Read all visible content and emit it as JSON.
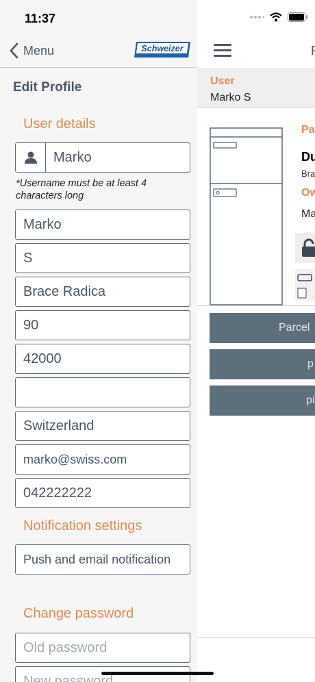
{
  "status_bar": {
    "time": "11:37"
  },
  "nav": {
    "back_label": "Menu",
    "logo_text": "Schweizer"
  },
  "page": {
    "title": "Edit Profile"
  },
  "sections": {
    "user_details": "User details",
    "notification_settings": "Notification settings",
    "change_password": "Change password"
  },
  "user_details": {
    "username": "Marko",
    "username_hint": "*Username must be at least 4 characters long",
    "first_name": "Marko",
    "last_name": "S",
    "street": "Brace Radica",
    "house_number": "90",
    "postal_code": "42000",
    "city": "",
    "country": "Switzerland",
    "email": "marko@swiss.com",
    "phone": "042222222"
  },
  "notification": {
    "value": "Push and email notification"
  },
  "password": {
    "old_placeholder": "Old password",
    "new_placeholder": "New password"
  },
  "background_screen": {
    "title_fragment": "P",
    "user_label": "User",
    "user_name": "Marko S",
    "side_label_1": "Pa",
    "side_bold": "Du",
    "side_small": "Bra",
    "side_label_2": "Ow",
    "side_text": "Ma",
    "button_1": "Parcel",
    "button_2": "p",
    "button_3": "pi"
  },
  "colors": {
    "accent": "#e08a53",
    "text": "#4a5866",
    "button": "#5e6f7c"
  }
}
